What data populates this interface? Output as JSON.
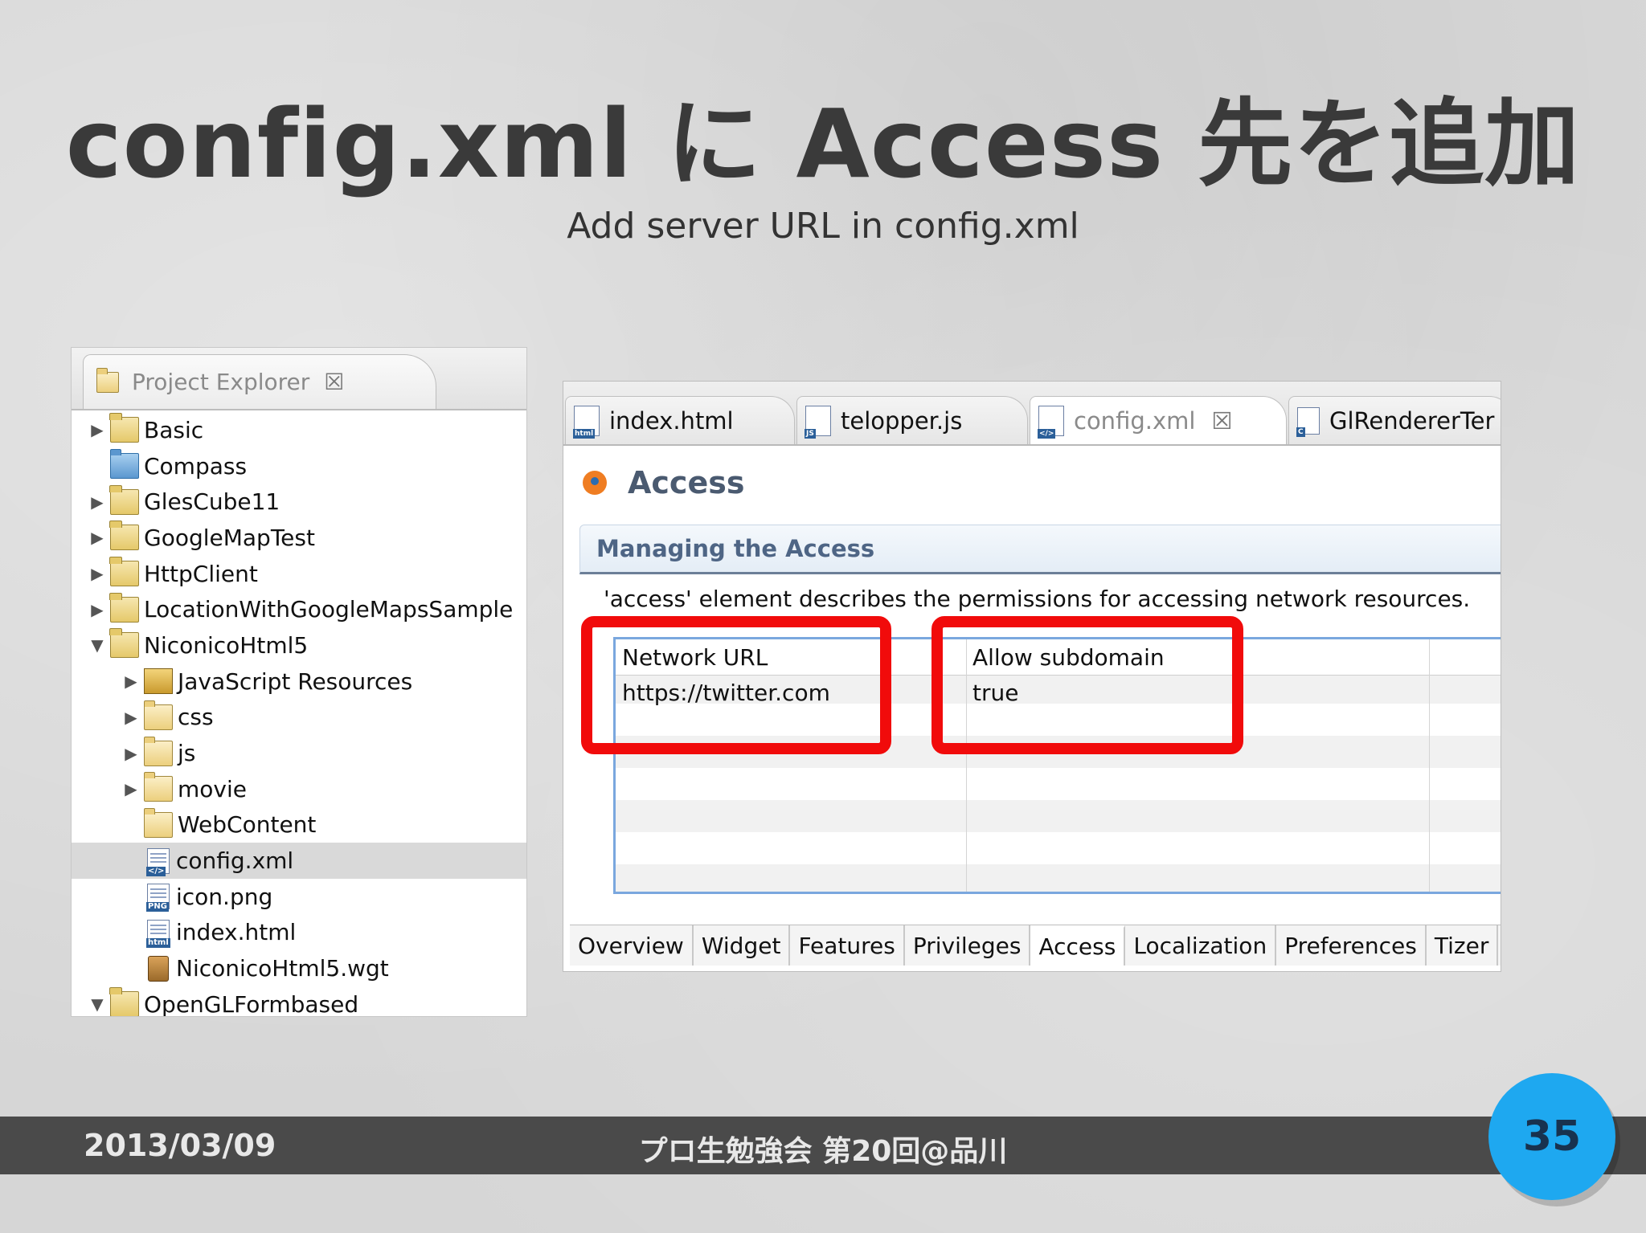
{
  "slide": {
    "title": "config.xml に Access 先を追加",
    "subtitle": "Add server URL in config.xml"
  },
  "explorer": {
    "tab_label": "Project Explorer",
    "close_glyph": "☒",
    "items": [
      {
        "label": "Basic",
        "expand": "▶",
        "depth": 0,
        "icon": "project-icon"
      },
      {
        "label": "Compass",
        "expand": "",
        "depth": 0,
        "icon": "blue-folder-icon"
      },
      {
        "label": "GlesCube11",
        "expand": "▶",
        "depth": 0,
        "icon": "project-icon"
      },
      {
        "label": "GoogleMapTest",
        "expand": "▶",
        "depth": 0,
        "icon": "project-icon"
      },
      {
        "label": "HttpClient",
        "expand": "▶",
        "depth": 0,
        "icon": "project-icon"
      },
      {
        "label": "LocationWithGoogleMapsSample",
        "expand": "▶",
        "depth": 0,
        "icon": "project-icon"
      },
      {
        "label": "NiconicoHtml5",
        "expand": "▼",
        "depth": 0,
        "icon": "project-icon"
      },
      {
        "label": "JavaScript Resources",
        "expand": "▶",
        "depth": 1,
        "icon": "js-resources-icon"
      },
      {
        "label": "css",
        "expand": "▶",
        "depth": 1,
        "icon": "folder-icon"
      },
      {
        "label": "js",
        "expand": "▶",
        "depth": 1,
        "icon": "folder-icon"
      },
      {
        "label": "movie",
        "expand": "▶",
        "depth": 1,
        "icon": "folder-icon"
      },
      {
        "label": "WebContent",
        "expand": "",
        "depth": 1,
        "icon": "folder-icon"
      },
      {
        "label": "config.xml",
        "expand": "",
        "depth": 1,
        "icon": "xml-file-icon"
      },
      {
        "label": "icon.png",
        "expand": "",
        "depth": 1,
        "icon": "png-file-icon"
      },
      {
        "label": "index.html",
        "expand": "",
        "depth": 1,
        "icon": "html-file-icon"
      },
      {
        "label": "NiconicoHtml5.wgt",
        "expand": "",
        "depth": 1,
        "icon": "wgt-file-icon"
      },
      {
        "label": "OpenGLFormbased",
        "expand": "▼",
        "depth": 0,
        "icon": "project-icon"
      }
    ]
  },
  "editor": {
    "tabs": [
      {
        "label": "index.html",
        "badge": "html"
      },
      {
        "label": "telopper.js",
        "badge": "JS"
      },
      {
        "label": "config.xml",
        "badge": "</>"
      },
      {
        "label": "GlRendererTer",
        "badge": "C"
      }
    ],
    "heading": "Access",
    "section_title": "Managing the Access",
    "description": "'access' element describes the permissions for accessing network resources.",
    "table": {
      "headers": [
        "Network URL",
        "Allow subdomain"
      ],
      "rows": [
        [
          "https://twitter.com",
          "true"
        ]
      ]
    },
    "bottom_tabs": [
      "Overview",
      "Widget",
      "Features",
      "Privileges",
      "Access",
      "Localization",
      "Preferences",
      "Tizer"
    ],
    "active_bottom_tab": "Access",
    "highlight_color": "#f10b0b"
  },
  "footer": {
    "date": "2013/03/09",
    "event": "プロ生勉強会 第20回@品川",
    "page_number": "35"
  }
}
